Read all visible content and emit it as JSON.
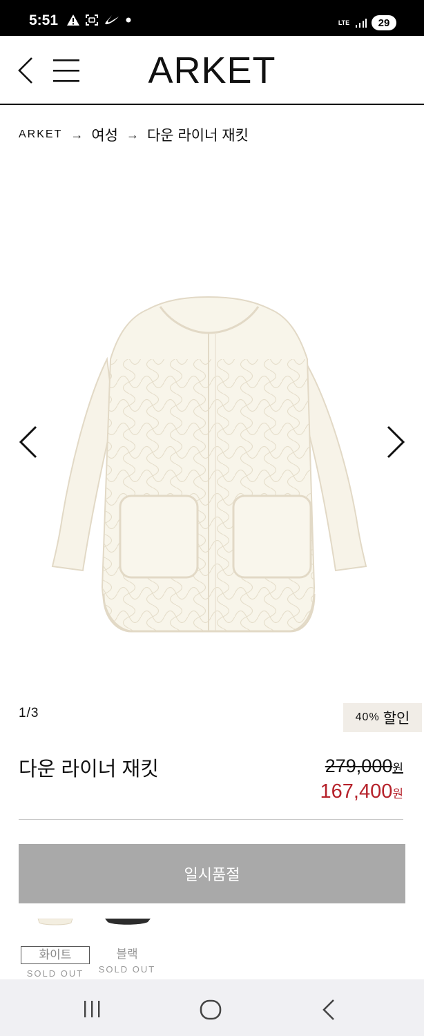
{
  "status_bar": {
    "time": "5:51",
    "left_icons": [
      "warning-icon",
      "screenshot-icon",
      "nike-app-icon",
      "notification-dot-icon"
    ],
    "network": "LTE",
    "battery": "29"
  },
  "header": {
    "brand": "ARKET",
    "back_icon": "chevron-left-icon",
    "menu_icon": "hamburger-menu-icon"
  },
  "breadcrumb": [
    {
      "label": "ARKET"
    },
    {
      "label": "여성"
    },
    {
      "label": "다운 라이너 재킷"
    }
  ],
  "breadcrumb_separator": "→",
  "gallery": {
    "counter": "1/3",
    "discount_pct": "40%",
    "discount_word": "할인",
    "image": "quilted-cream-jacket"
  },
  "product": {
    "title": "다운 라이너 재킷",
    "price_original": "279,000",
    "price_sale": "167,400",
    "currency": "원",
    "sale_color": "#b6222b"
  },
  "cta": {
    "label": "일시품절"
  },
  "colors": [
    {
      "label": "화이트",
      "status": "SOLD OUT",
      "selected": true
    },
    {
      "label": "블랙",
      "status": "SOLD OUT",
      "selected": false
    }
  ],
  "nav": {
    "recents_icon": "recents-icon",
    "home_icon": "home-icon",
    "back_icon": "back-icon"
  }
}
